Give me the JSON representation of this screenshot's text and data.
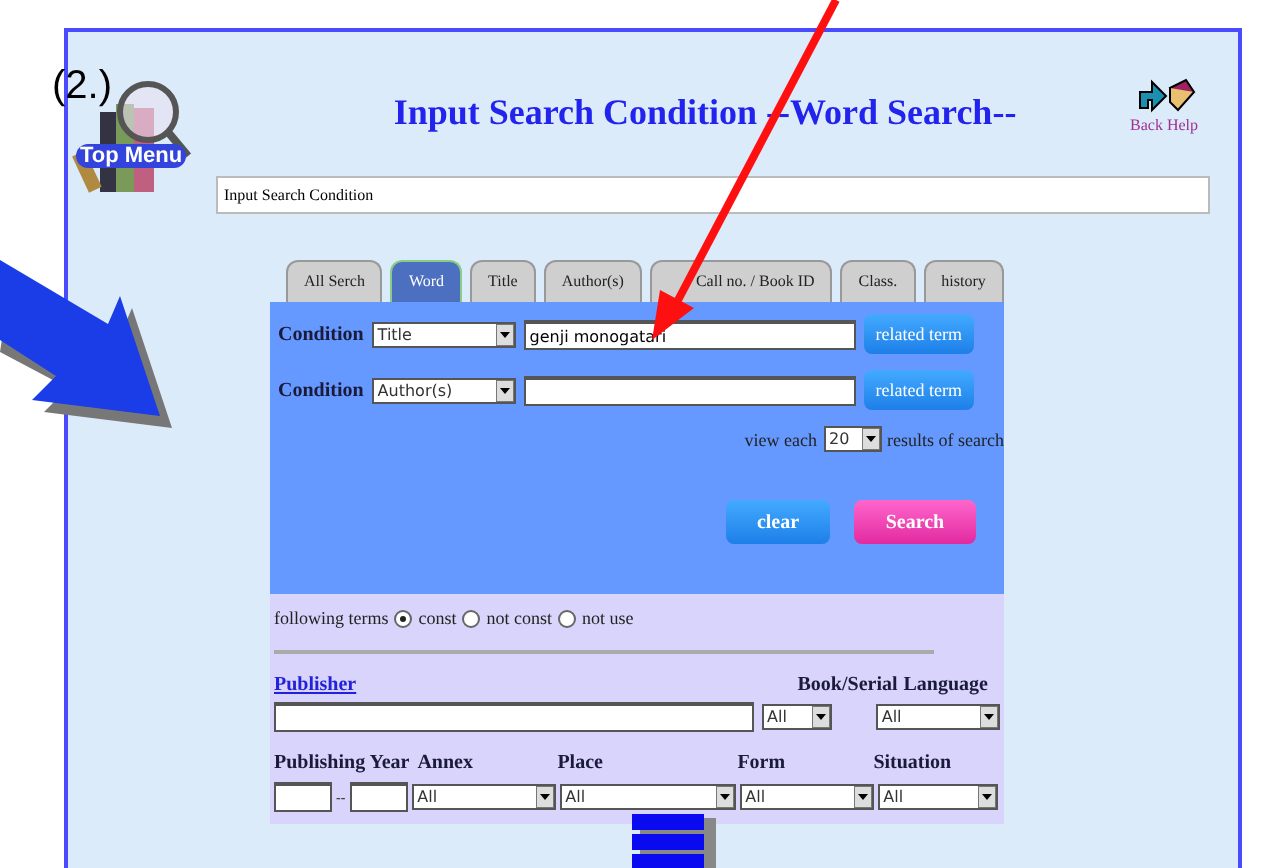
{
  "annotation": {
    "label": "(2.)"
  },
  "header": {
    "logo_label": "Top Menu",
    "title": "Input Search Condition --Word Search--",
    "nav_label": "Back Help"
  },
  "breadcrumb": {
    "value": "Input Search Condition"
  },
  "tabs": [
    {
      "label": "All Serch",
      "selected": false
    },
    {
      "label": "Word",
      "selected": true
    },
    {
      "label": "Title",
      "selected": false
    },
    {
      "label": "Author(s)",
      "selected": false
    },
    {
      "label": "Call no. / Book ID",
      "selected": false
    },
    {
      "label": "Class.",
      "selected": false
    },
    {
      "label": "history",
      "selected": false
    }
  ],
  "conditions": [
    {
      "label": "Condition",
      "field": "Title",
      "value": "genji monogatari",
      "button": "related term"
    },
    {
      "label": "Condition",
      "field": "Author(s)",
      "button": "related term"
    }
  ],
  "view": {
    "prefix": "view each",
    "count": "20",
    "suffix": "results of search"
  },
  "buttons": [
    {
      "label": "clear",
      "kind": "clear"
    },
    {
      "label": "Search",
      "kind": "search"
    }
  ],
  "following": {
    "label": "following terms",
    "options": [
      {
        "label": "const",
        "selected": true
      },
      {
        "label": "not const",
        "selected": false
      },
      {
        "label": "not use",
        "selected": false
      }
    ]
  },
  "publisher": {
    "label": "Publisher"
  },
  "book_serial": {
    "label": "Book/Serial",
    "value": "All"
  },
  "language": {
    "label": "Language",
    "value": "All"
  },
  "publishing_year": {
    "label": "Publishing Year",
    "separator": "--"
  },
  "annex": {
    "label": "Annex",
    "value": "All"
  },
  "place": {
    "label": "Place",
    "value": "All"
  },
  "form": {
    "label": "Form",
    "value": "All"
  },
  "situation": {
    "label": "Situation",
    "value": "All"
  }
}
